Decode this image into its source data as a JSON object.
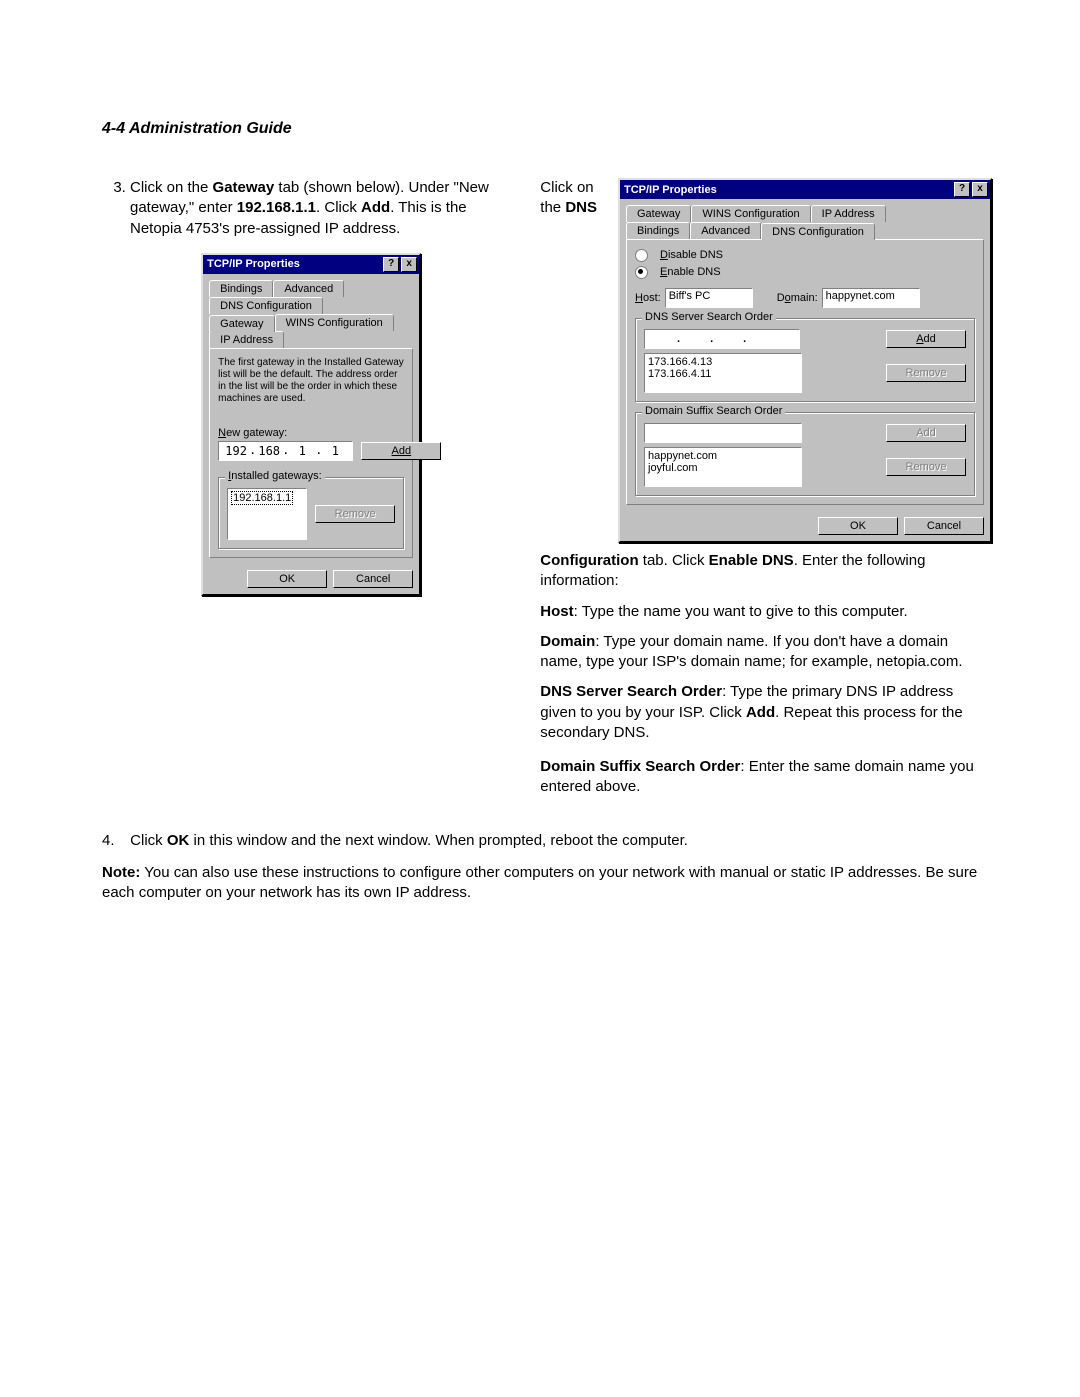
{
  "header": "4-4  Administration Guide",
  "step3": {
    "pre": "Click on the ",
    "gateway": "Gateway",
    "mid1": " tab (shown below). Under \"New gateway,\" enter ",
    "ip": "192.168.1.1",
    "mid2": ". Click ",
    "add": "Add",
    "tail": ". This is the Netopia 4753's pre-assigned IP address."
  },
  "dialog1": {
    "title": "TCP/IP Properties",
    "help": "?",
    "close": "x",
    "tabs_row1": [
      "Bindings",
      "Advanced",
      "DNS Configuration"
    ],
    "tabs_row2": [
      "Gateway",
      "WINS Configuration",
      "IP Address"
    ],
    "desc": "The first gateway in the Installed Gateway list will be the default. The address order in the list will be the order in which these machines are used.",
    "new_gw_label_pre": "N",
    "new_gw_label": "ew gateway:",
    "ip_octets": [
      "192",
      "168",
      "1",
      "1"
    ],
    "add_btn": "Add",
    "installed_label_pre": "I",
    "installed_label": "nstalled gateways:",
    "installed_item": "192.168.1.1",
    "remove_btn": "Remove",
    "ok": "OK",
    "cancel": "Cancel"
  },
  "right_intro": {
    "p1a": "Click on the ",
    "p1b": "DNS Configuration",
    "p1c": " tab. Click ",
    "p1d": "Enable DNS",
    "p1e": ". Enter the following information:",
    "host_b": "Host",
    "host_t": ": Type the name you want to give to this computer.",
    "domain_b": "Domain",
    "domain_t": ": Type your domain name. If you don't have a domain name, type your ISP's domain name; for example, netopia.com.",
    "dsso_b": "DNS Server Search Order",
    "dsso_t": ": Type the primary DNS IP address given to you by your ISP. Click ",
    "add_b": "Add",
    "add_t": ". Repeat this process for the secondary DNS.",
    "dss_b": "Domain Suffix Search Order",
    "dss_t": ": Enter the same domain name you entered above."
  },
  "dialog2": {
    "title": "TCP/IP Properties",
    "help": "?",
    "close": "x",
    "tabs_row1": [
      "Gateway",
      "WINS Configuration",
      "IP Address"
    ],
    "tabs_row2": [
      "Bindings",
      "Advanced",
      "DNS Configuration"
    ],
    "disable_pre": "D",
    "disable_label": "isable DNS",
    "enable_pre": "E",
    "enable_label": "nable DNS",
    "host_pre": "H",
    "host_label": "ost:",
    "host_val": "Biff's PC",
    "domain_pre": "o",
    "domain_label_pre": "D",
    "domain_label_post": "main:",
    "domain_val": "happynet.com",
    "dsso_legend": "DNS Server Search Order",
    "dss_list": [
      "173.166.4.13",
      "173.166.4.11"
    ],
    "add_btn_u": "A",
    "add_btn": "dd",
    "remove_btn": "Remove",
    "suffix_legend": "Domain Suffix Search Order",
    "suffix_list": [
      "happynet.com",
      "joyful.com"
    ],
    "add2": "Add",
    "remove2": "Remove",
    "ok": "OK",
    "cancel": "Cancel"
  },
  "step4": {
    "num": "4.",
    "pre": "Click ",
    "ok": "OK",
    "post": " in this window and the next window. When prompted, reboot the computer."
  },
  "note": {
    "b": "Note:",
    "t": " You can also use these instructions to configure other computers on your network with manual or static IP addresses. Be sure each computer on your network has its own IP address."
  }
}
